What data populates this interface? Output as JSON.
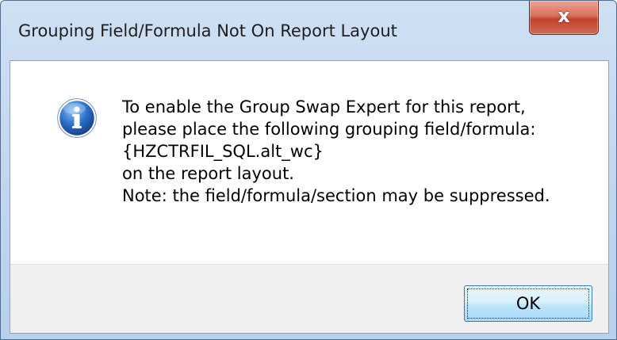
{
  "dialog": {
    "title": "Grouping Field/Formula Not On Report Layout",
    "close_label": "x",
    "icon": "info-icon",
    "message_lines": [
      "To enable the Group Swap Expert for this report,",
      "please place the following grouping field/formula:",
      "{HZCTRFIL_SQL.alt_wc}",
      "on the report layout.",
      "Note: the field/formula/section may be suppressed."
    ],
    "ok_label": "OK"
  },
  "colors": {
    "frame": "#c4d8ef",
    "close_button": "#c0432d",
    "button_area": "#f0f0f0",
    "ok_button": "#bee6fd",
    "info_icon": "#2a6fc9"
  }
}
